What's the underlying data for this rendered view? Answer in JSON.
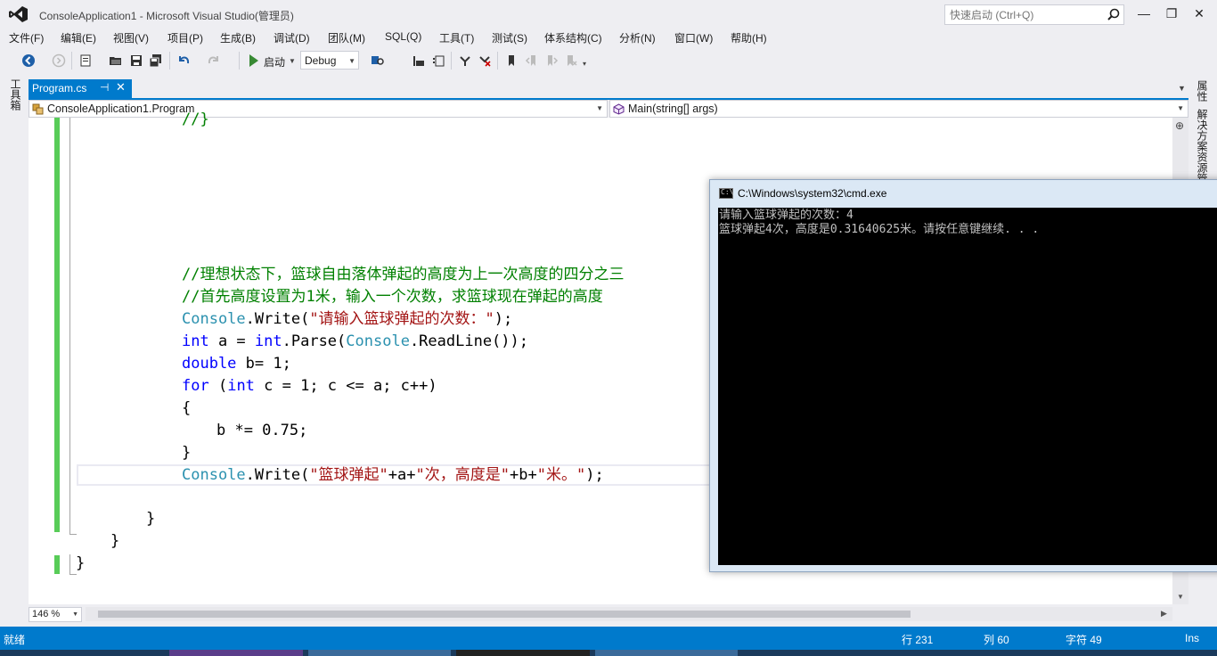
{
  "window": {
    "title": "ConsoleApplication1 - Microsoft Visual Studio(管理员)",
    "quick_launch_placeholder": "快速启动 (Ctrl+Q)",
    "minimize_glyph": "—",
    "maximize_glyph": "❐",
    "close_glyph": "✕"
  },
  "menu": [
    "文件(F)",
    "编辑(E)",
    "视图(V)",
    "项目(P)",
    "生成(B)",
    "调试(D)",
    "团队(M)",
    "SQL(Q)",
    "工具(T)",
    "测试(S)",
    "体系结构(C)",
    "分析(N)",
    "窗口(W)",
    "帮助(H)"
  ],
  "toolbar": {
    "start_label": "启动",
    "configuration": "Debug"
  },
  "side_tabs": {
    "left": "工具箱",
    "right_top": "属性",
    "right_bottom": "解决方案资源管理器"
  },
  "document_tab": {
    "label": "Program.cs",
    "pin_glyph": "⊣",
    "close_glyph": "✕"
  },
  "navbar": {
    "class_label": "ConsoleApplication1.Program",
    "member_label": "Main(string[] args)"
  },
  "code": {
    "line0": "//}",
    "line1": "//理想状态下，篮球自由落体弹起的高度为上一次高度的四分之三",
    "line2": "//首先高度设置为1米，输入一个次数，求篮球现在弹起的高度",
    "line3": {
      "t1": "Console",
      "t2": ".Write(",
      "t3": "\"请输入篮球弹起的次数：\"",
      "t4": ");"
    },
    "line4": {
      "k1": "int",
      "t1": " a = ",
      "k2": "int",
      "t2": ".Parse(",
      "t3": "Console",
      "t4": ".ReadLine());"
    },
    "line5": {
      "k1": "double",
      "t1": " b= 1;"
    },
    "line6": {
      "k1": "for",
      "t1": " (",
      "k2": "int",
      "t2": " c = 1; c <= a; c++)"
    },
    "line7": "{",
    "line8": "b *= 0.75;",
    "line9": "}",
    "line10": {
      "t1": "Console",
      "t2": ".Write(",
      "s1": "\"篮球弹起\"",
      "t3": "+a+",
      "s2": "\"次，高度是\"",
      "t4": "+b+",
      "s3": "\"米。\"",
      "t5": ");"
    },
    "line11": "}",
    "line12": "}",
    "line13": "}"
  },
  "editor_bottom": {
    "zoom": "146 %"
  },
  "statusbar": {
    "ready": "就绪",
    "line": "行 231",
    "column": "列 60",
    "char": "字符 49",
    "mode": "Ins"
  },
  "cmd": {
    "title": "C:\\Windows\\system32\\cmd.exe",
    "icon_text": "C:\\",
    "output_line1": "请输入篮球弹起的次数：4",
    "output_line2": "篮球弹起4次，高度是0.31640625米。请按任意键继续. . ."
  },
  "colors": {
    "accent": "#007acc",
    "comment": "#008000",
    "keyword": "#0000ff",
    "type": "#2b91af",
    "string": "#a31515",
    "changed_marker": "#58cc58"
  }
}
